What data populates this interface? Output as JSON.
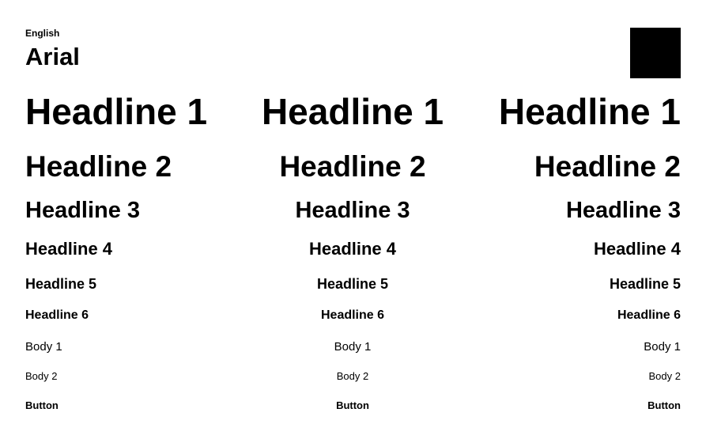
{
  "header": {
    "language": "English",
    "font_name": "Arial"
  },
  "swatch": {
    "color": "#000000"
  },
  "samples": {
    "h1": "Headline 1",
    "h2": "Headline 2",
    "h3": "Headline 3",
    "h4": "Headline 4",
    "h5": "Headline 5",
    "h6": "Headline 6",
    "body1": "Body 1",
    "body2": "Body 2",
    "button": "Button"
  }
}
